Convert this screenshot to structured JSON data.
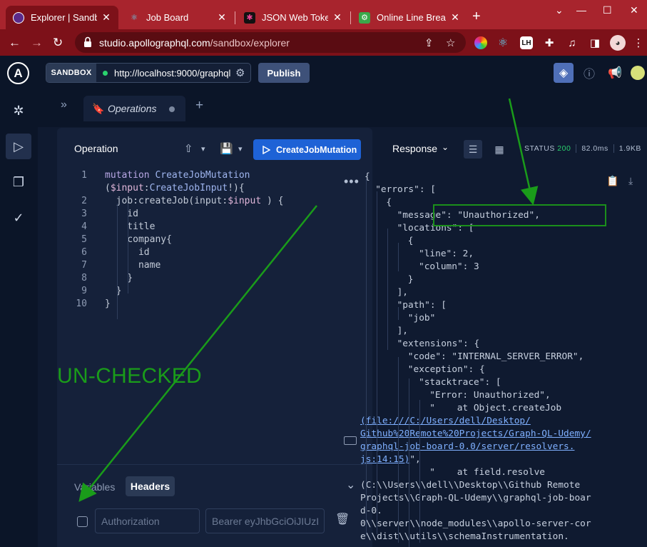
{
  "browser": {
    "tabs": [
      {
        "title": "Explorer | Sandbox",
        "active": true
      },
      {
        "title": "Job Board",
        "active": false
      },
      {
        "title": "JSON Web Tokens",
        "active": false
      },
      {
        "title": "Online Line Break",
        "active": false
      }
    ],
    "url_domain": "studio.apollographql.com",
    "url_path": "/sandbox/explorer",
    "accent_color": "#a8242d"
  },
  "header": {
    "sandbox_label": "SANDBOX",
    "endpoint": "http://localhost:9000/graphql",
    "publish_label": "Publish"
  },
  "workspace": {
    "tab_label": "Operations"
  },
  "operation": {
    "title": "Operation",
    "run_label": "CreateJobMutation",
    "lines": [
      {
        "n": "1",
        "segments": [
          [
            "kw",
            "mutation "
          ],
          [
            "fn",
            "CreateJobMutation"
          ]
        ]
      },
      {
        "n": "",
        "segments": [
          [
            "fld",
            "("
          ],
          [
            "var",
            "$input"
          ],
          [
            "fld",
            ":"
          ],
          [
            "ty",
            "CreateJobInput"
          ],
          [
            "fld",
            "!){"
          ]
        ]
      },
      {
        "n": "2",
        "segments": [
          [
            "fld",
            "  job:createJob(input:"
          ],
          [
            "var",
            "$input"
          ],
          [
            "fld",
            " ) {"
          ]
        ]
      },
      {
        "n": "3",
        "segments": [
          [
            "fld",
            "    id"
          ]
        ]
      },
      {
        "n": "4",
        "segments": [
          [
            "fld",
            "    title"
          ]
        ]
      },
      {
        "n": "5",
        "segments": [
          [
            "fld",
            "    company{"
          ]
        ]
      },
      {
        "n": "6",
        "segments": [
          [
            "fld",
            "      id"
          ]
        ]
      },
      {
        "n": "7",
        "segments": [
          [
            "fld",
            "      name"
          ]
        ]
      },
      {
        "n": "8",
        "segments": [
          [
            "fld",
            "    }"
          ]
        ]
      },
      {
        "n": "9",
        "segments": [
          [
            "fld",
            "  }"
          ]
        ]
      },
      {
        "n": "10",
        "segments": [
          [
            "fld",
            "}"
          ]
        ]
      }
    ]
  },
  "bottom_panel": {
    "variables_label": "Variables",
    "headers_label": "Headers",
    "header_key_placeholder": "Authorization",
    "header_value_placeholder": "Bearer eyJhbGciOiJIUzI"
  },
  "response": {
    "title": "Response",
    "status_label": "STATUS",
    "status_code": "200",
    "time": "82.0ms",
    "size": "1.9KB",
    "lines": [
      {
        "indent": 0,
        "text": "{"
      },
      {
        "indent": 1,
        "text": "\"errors\": ["
      },
      {
        "indent": 2,
        "text": "{"
      },
      {
        "indent": 3,
        "text": "\"message\": \"Unauthorized\","
      },
      {
        "indent": 3,
        "text": "\"locations\": ["
      },
      {
        "indent": 4,
        "text": "{"
      },
      {
        "indent": 5,
        "text": "\"line\": 2,"
      },
      {
        "indent": 5,
        "text": "\"column\": 3"
      },
      {
        "indent": 4,
        "text": "}"
      },
      {
        "indent": 3,
        "text": "],"
      },
      {
        "indent": 3,
        "text": "\"path\": ["
      },
      {
        "indent": 4,
        "text": "\"job\""
      },
      {
        "indent": 3,
        "text": "],"
      },
      {
        "indent": 3,
        "text": "\"extensions\": {"
      },
      {
        "indent": 4,
        "text": "\"code\": \"INTERNAL_SERVER_ERROR\","
      },
      {
        "indent": 4,
        "text": "\"exception\": {"
      },
      {
        "indent": 5,
        "text": "\"stacktrace\": ["
      },
      {
        "indent": 6,
        "text": "\"Error: Unauthorized\","
      },
      {
        "indent": 6,
        "text": "\"    at Object.createJob"
      },
      {
        "indent": -1,
        "text": "(file:///C:/Users/dell/Desktop/",
        "link": true
      },
      {
        "indent": -1,
        "text": "Github%20Remote%20Projects/Graph-QL-Udemy/",
        "link": true
      },
      {
        "indent": -1,
        "text": "graphql-job-board-0.0/server/resolvers.",
        "link": true
      },
      {
        "indent": -1,
        "text": "js:14:15)",
        "link": true,
        "suffix": "\","
      },
      {
        "indent": 6,
        "text": "\"    at field.resolve"
      },
      {
        "indent": -1,
        "text": "(C:\\\\Users\\\\dell\\\\Desktop\\\\Github Remote"
      },
      {
        "indent": -1,
        "text": "Projects\\\\Graph-QL-Udemy\\\\graphql-job-boar"
      },
      {
        "indent": -1,
        "text": "d-0."
      },
      {
        "indent": -1,
        "text": "0\\\\server\\\\node_modules\\\\apollo-server-cor"
      },
      {
        "indent": -1,
        "text": "e\\\\dist\\\\utils\\\\schemaInstrumentation."
      }
    ]
  },
  "annotation": {
    "label": "UN-CHECKED",
    "color": "#1a9c1a"
  }
}
